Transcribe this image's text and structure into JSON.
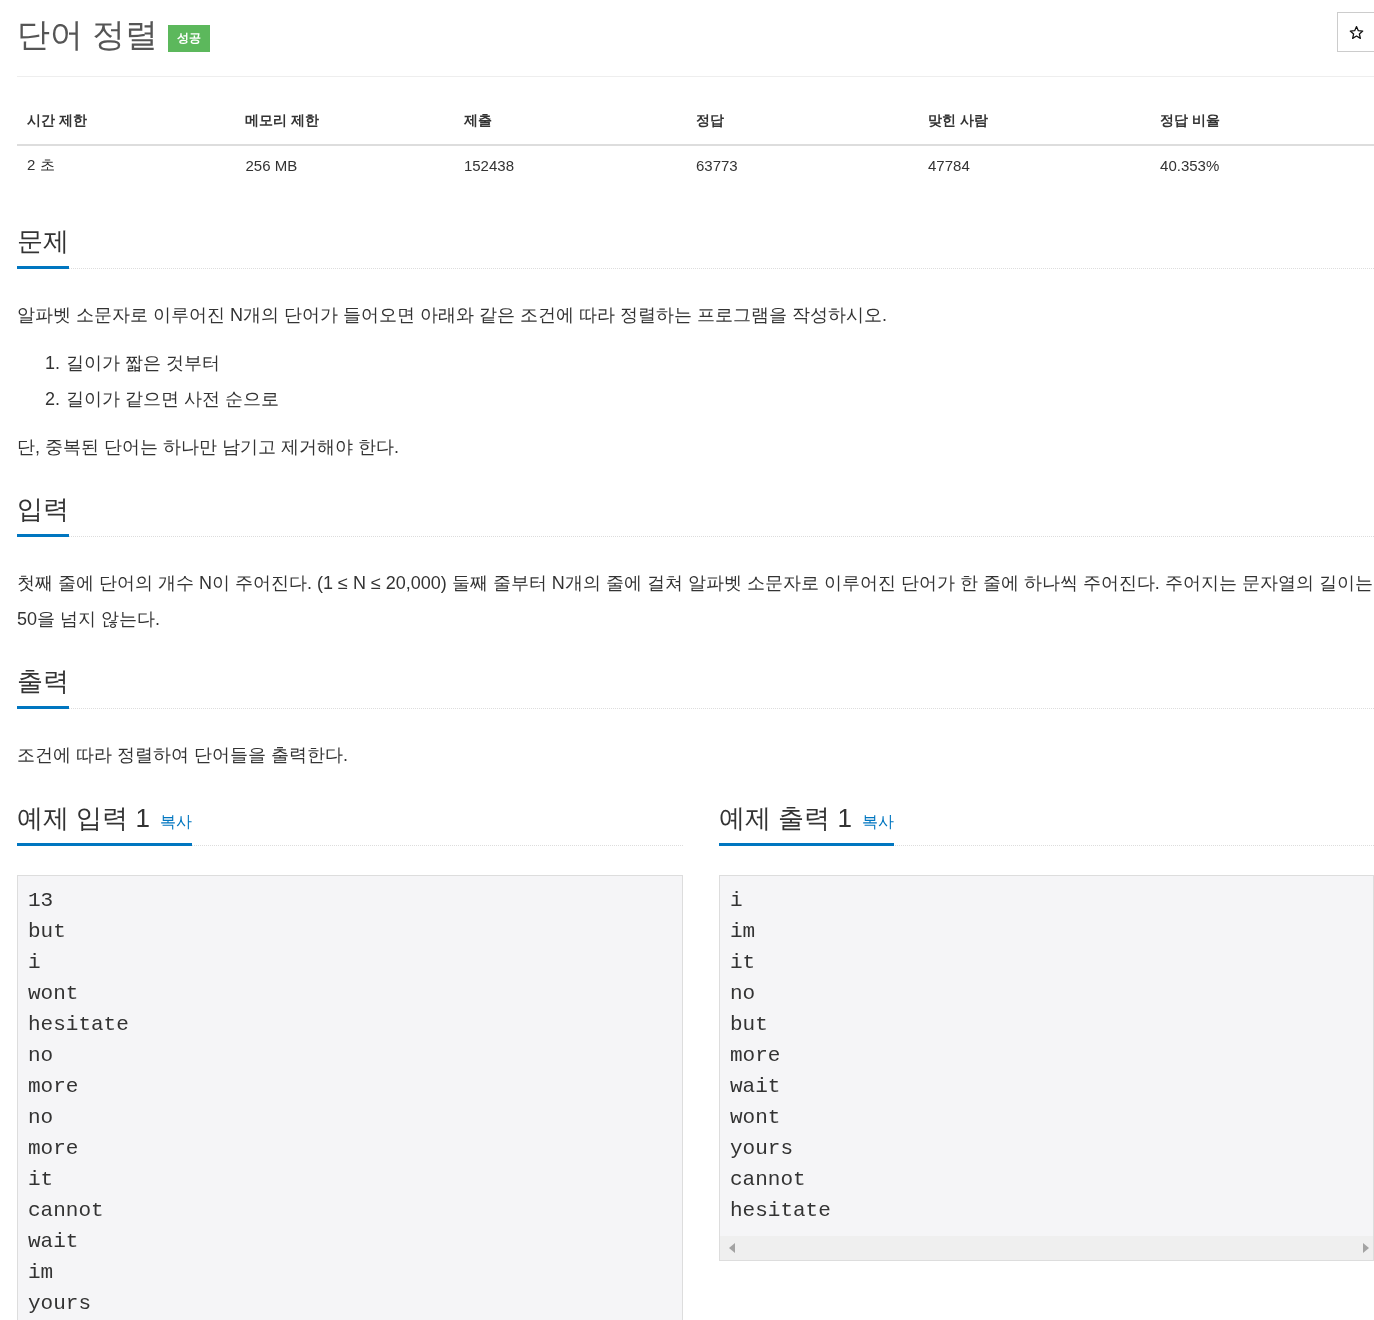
{
  "title": "단어 정렬",
  "badge": "성공",
  "stats": {
    "columns": [
      "시간 제한",
      "메모리 제한",
      "제출",
      "정답",
      "맞힌 사람",
      "정답 비율"
    ],
    "rows": [
      [
        "2 초",
        "256 MB",
        "152438",
        "63773",
        "47784",
        "40.353%"
      ]
    ]
  },
  "sections": [
    {
      "heading": "문제",
      "blocks": [
        {
          "kind": "paragraph",
          "text": "알파벳 소문자로 이루어진 N개의 단어가 들어오면 아래와 같은 조건에 따라 정렬하는 프로그램을 작성하시오."
        },
        {
          "kind": "ordered_list",
          "items": [
            {
              "number": "1.",
              "text": "길이가 짧은 것부터"
            },
            {
              "number": "2.",
              "text": "길이가 같으면 사전 순으로"
            }
          ]
        },
        {
          "kind": "paragraph",
          "text": "단, 중복된 단어는 하나만 남기고 제거해야 한다."
        }
      ]
    },
    {
      "heading": "입력",
      "blocks": [
        {
          "kind": "paragraph",
          "text": "첫째 줄에 단어의 개수 N이 주어진다. (1 ≤ N ≤ 20,000) 둘째 줄부터 N개의 줄에 걸쳐 알파벳 소문자로 이루어진 단어가 한 줄에 하나씩 주어진다. 주어지는 문자열의 길이는 50을 넘지 않는다."
        }
      ]
    },
    {
      "heading": "출력",
      "blocks": [
        {
          "kind": "paragraph",
          "text": "조건에 따라 정렬하여 단어들을 출력한다."
        }
      ]
    }
  ],
  "samples": [
    {
      "heading": "예제 입력 1",
      "copy": "복사",
      "lines": [
        "13",
        "but",
        "i",
        "wont",
        "hesitate",
        "no",
        "more",
        "no",
        "more",
        "it",
        "cannot",
        "wait",
        "im",
        "yours"
      ]
    },
    {
      "heading": "예제 출력 1",
      "copy": "복사",
      "horizontal_scrollbar": true,
      "lines": [
        "i",
        "im",
        "it",
        "no",
        "but",
        "more",
        "wait",
        "wont",
        "yours",
        "cannot",
        "hesitate"
      ]
    }
  ]
}
